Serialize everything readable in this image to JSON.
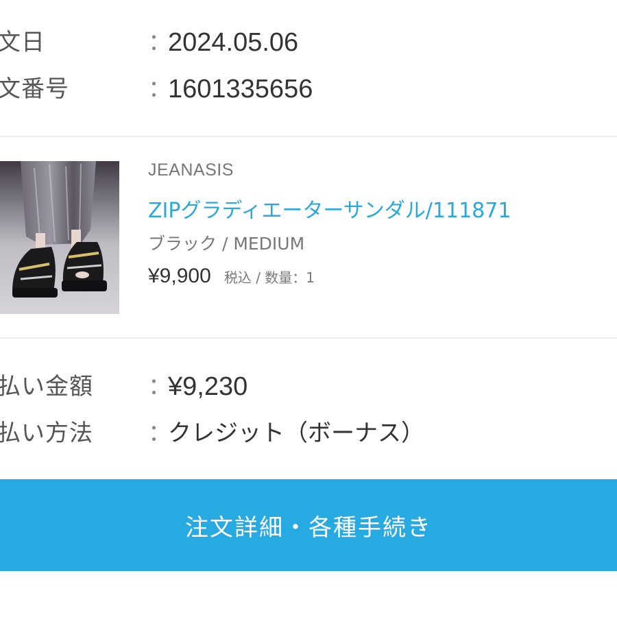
{
  "order_info": {
    "order_date_label": "文日",
    "order_date_value": "2024.05.06",
    "order_number_label": "文番号",
    "order_number_value": "1601335656",
    "separator": "："
  },
  "product": {
    "brand": "JEANASIS",
    "name": "ZIPグラディエーターサンダル/111871",
    "variant": "ブラック / MEDIUM",
    "price": "¥9,900",
    "tax_quantity": "税込 / 数量：1",
    "image_icon": "sandal-product-photo"
  },
  "payment_info": {
    "amount_label": "払い金額",
    "amount_value": "¥9,230",
    "method_label": "払い方法",
    "method_value": "クレジット（ボーナス）",
    "separator": "："
  },
  "actions": {
    "details_button_label": "注文詳細・各種手続き"
  },
  "colors": {
    "accent": "#27a9e1",
    "link": "#2aa8d8",
    "text": "#333333",
    "muted": "#777777",
    "divider": "#eeeeee"
  }
}
